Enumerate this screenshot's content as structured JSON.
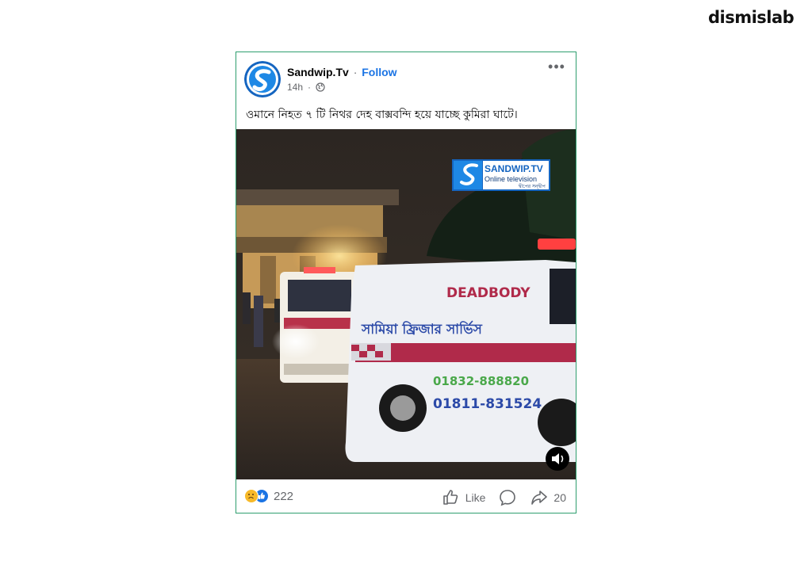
{
  "brand": {
    "name": "dismislab"
  },
  "post": {
    "author": "Sandwip.Tv",
    "separator": "·",
    "follow_label": "Follow",
    "time": "14h",
    "more_label": "•••",
    "caption": "ওমানে নিহত ৭ টি নিথর দেহ বাক্সবন্দি হয়ে যাচ্ছে কুমিরা ঘাটে।",
    "video": {
      "watermark_title": "SANDWIP.TV",
      "watermark_subtitle": "Online television",
      "watermark_tag": "দ্বীপের সন্দ্বীপ",
      "van_text_1": "DEADBODY",
      "van_text_2": "সামিয়া ফ্রিজার সার্ভিস",
      "van_phone_1": "01832-888820",
      "van_phone_2": "01811-831524"
    },
    "reactions_count": "222",
    "like_label": "Like",
    "share_count": "20"
  },
  "colors": {
    "accent": "#1b74e4",
    "border": "#2e9e6e",
    "muted": "#65676b"
  }
}
